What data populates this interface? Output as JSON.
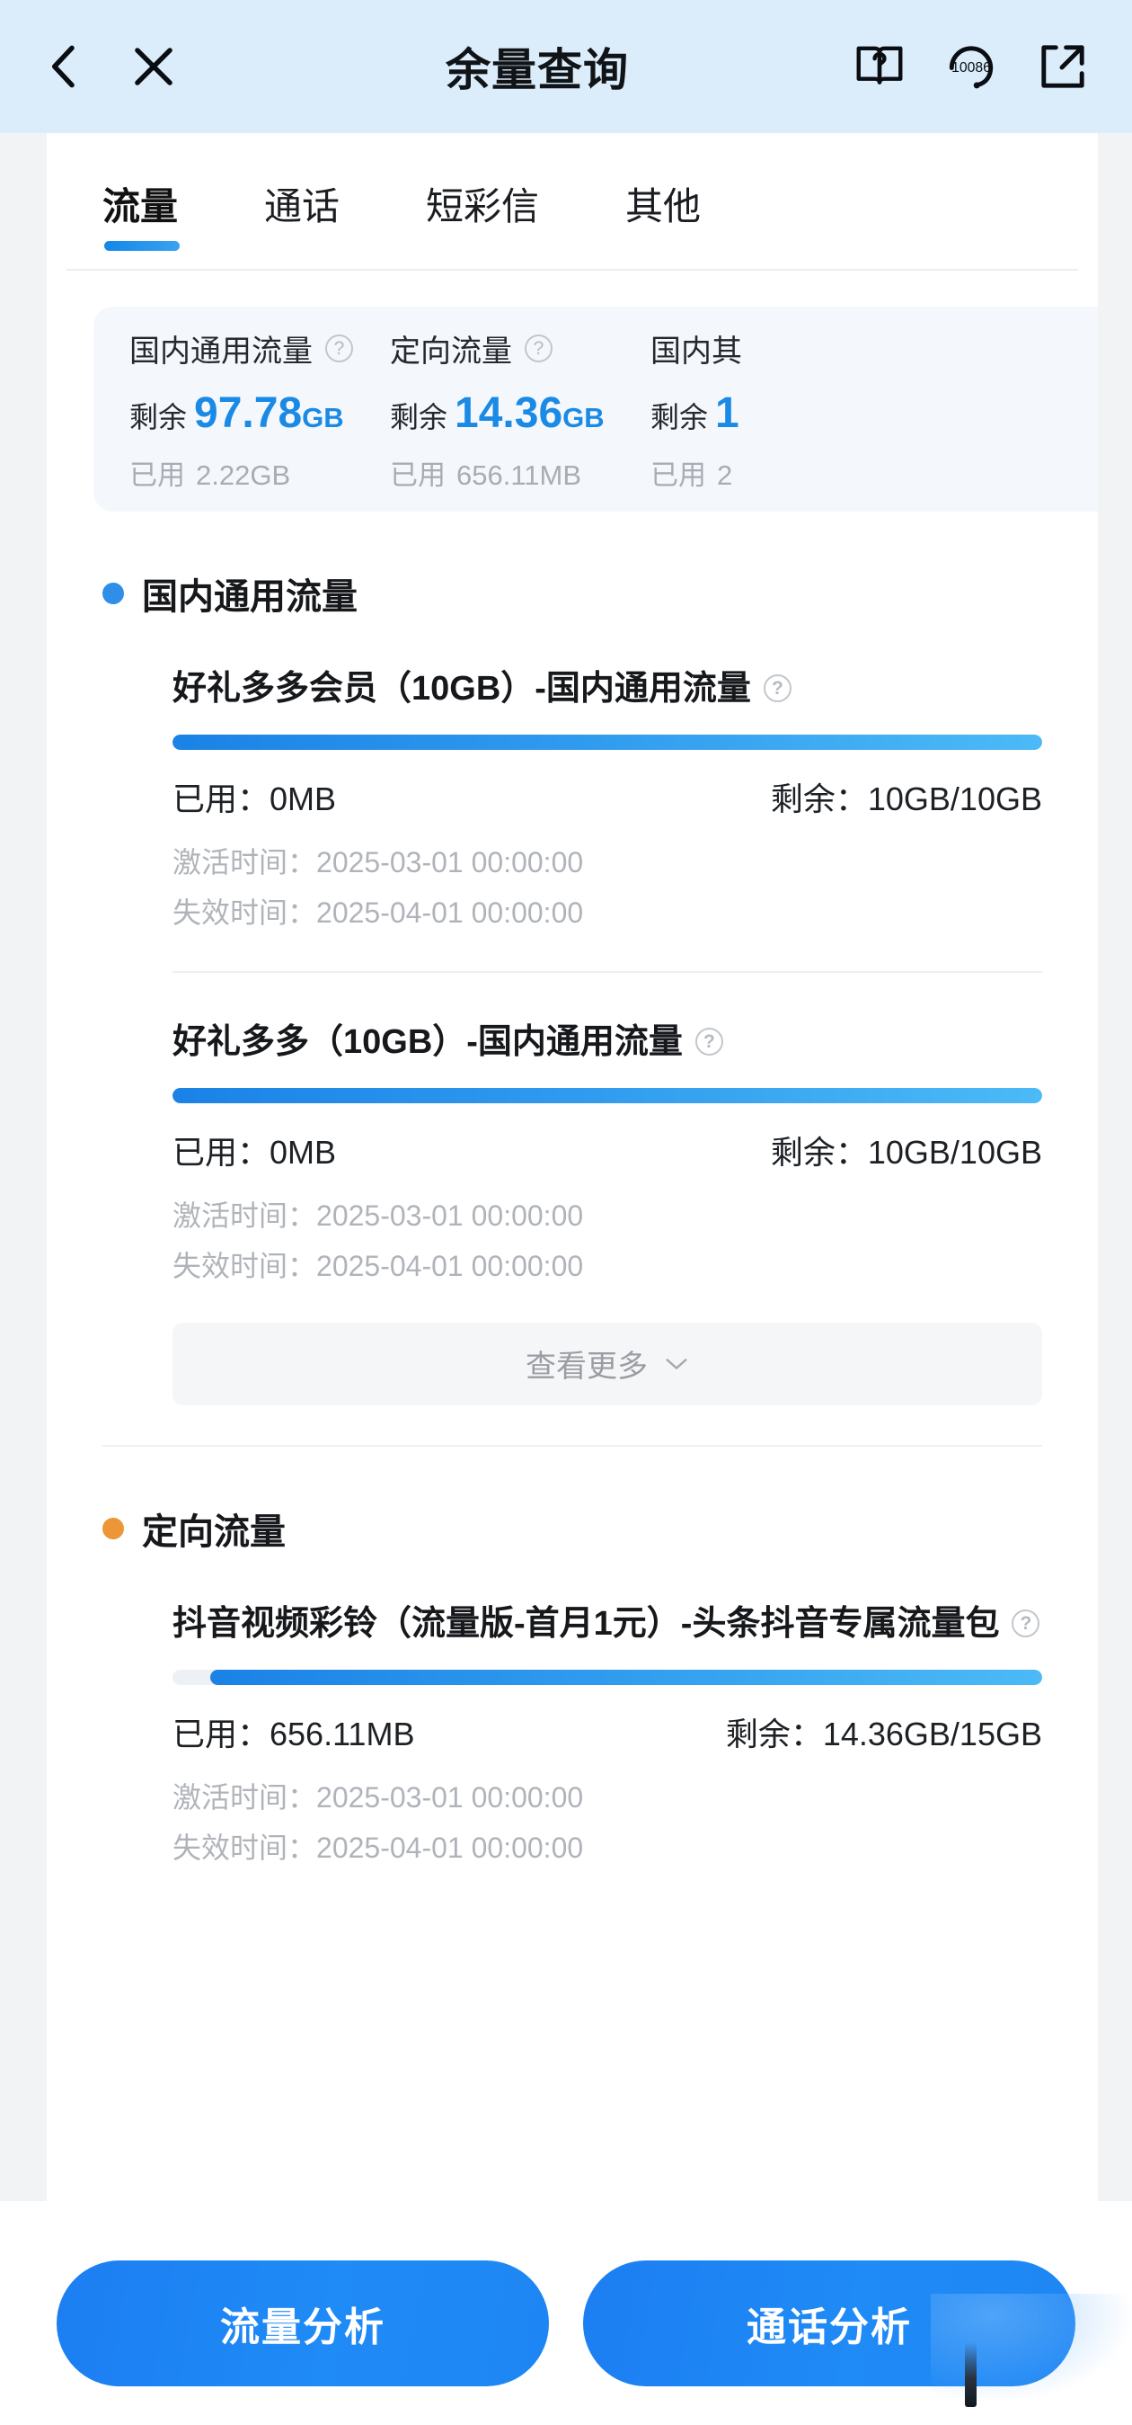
{
  "header": {
    "title": "余量查询",
    "back_icon": "chevron-left-icon",
    "close_icon": "close-icon",
    "help_icon": "book-question-icon",
    "hotline_icon": "headset-icon",
    "hotline_number": "10086",
    "share_icon": "external-link-icon"
  },
  "tabs": [
    {
      "label": "流量",
      "active": true
    },
    {
      "label": "通话",
      "active": false
    },
    {
      "label": "短彩信",
      "active": false
    },
    {
      "label": "其他",
      "active": false
    }
  ],
  "summary": {
    "remain_label": "剩余",
    "used_label": "已用",
    "cards": [
      {
        "title": "国内通用流量",
        "remain_value": "97.78",
        "remain_unit": "GB",
        "used": "2.22GB"
      },
      {
        "title": "定向流量",
        "remain_value": "14.36",
        "remain_unit": "GB",
        "used": "656.11MB"
      },
      {
        "title": "国内其",
        "remain_value": "1",
        "remain_unit": "",
        "used": "2"
      }
    ]
  },
  "sections": [
    {
      "title": "国内通用流量",
      "dot_color": "#2f8ee8",
      "items": [
        {
          "name": "好礼多多会员（10GB）-国内通用流量",
          "used_label": "已用：",
          "used_value": "0MB",
          "remain_label": "剩余：",
          "remain_value": "10GB/10GB",
          "activate_label": "激活时间：",
          "activate_value": "2025-03-01 00:00:00",
          "expire_label": "失效时间：",
          "expire_value": "2025-04-01 00:00:00",
          "fill_percent": 100
        },
        {
          "name": "好礼多多（10GB）-国内通用流量",
          "used_label": "已用：",
          "used_value": "0MB",
          "remain_label": "剩余：",
          "remain_value": "10GB/10GB",
          "activate_label": "激活时间：",
          "activate_value": "2025-03-01 00:00:00",
          "expire_label": "失效时间：",
          "expire_value": "2025-04-01 00:00:00",
          "fill_percent": 100
        }
      ],
      "more_label": "查看更多"
    },
    {
      "title": "定向流量",
      "dot_color": "#ec9638",
      "items": [
        {
          "name": "抖音视频彩铃（流量版-首月1元）-头条抖音专属流量包",
          "used_label": "已用：",
          "used_value": "656.11MB",
          "remain_label": "剩余：",
          "remain_value": "14.36GB/15GB",
          "activate_label": "激活时间：",
          "activate_value": "2025-03-01 00:00:00",
          "expire_label": "失效时间：",
          "expire_value": "2025-04-01 00:00:00",
          "fill_percent": 95.7
        }
      ]
    }
  ],
  "bottom": {
    "data_analysis_label": "流量分析",
    "call_analysis_label": "通话分析"
  },
  "colors": {
    "accent_blue": "#1a8ae5",
    "header_bg": "#dbecfb",
    "section_orange": "#ec9638"
  }
}
